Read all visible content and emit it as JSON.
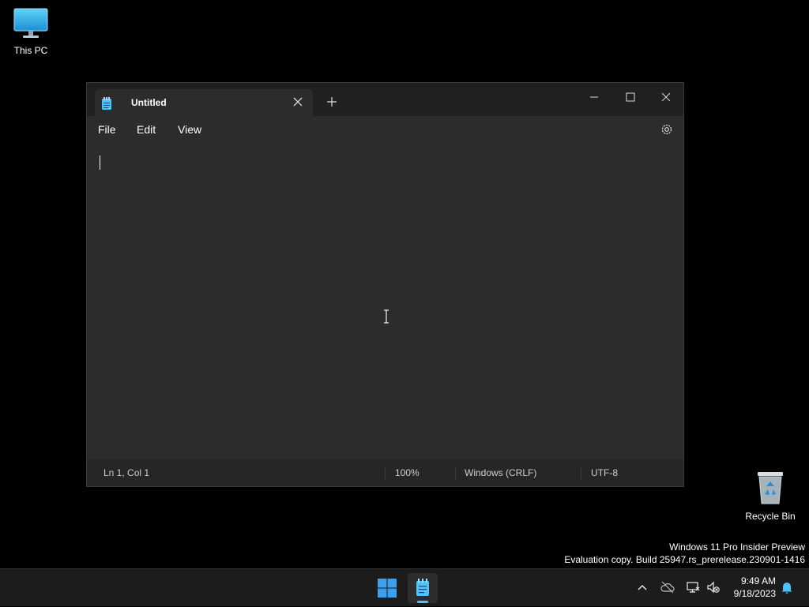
{
  "desktop": {
    "this_pc_label": "This PC",
    "recycle_bin_label": "Recycle Bin",
    "watermark_line1": "Windows 11 Pro Insider Preview",
    "watermark_line2": "Evaluation copy. Build 25947.rs_prerelease.230901-1416"
  },
  "notepad": {
    "tab_title": "Untitled",
    "menu": [
      "File",
      "Edit",
      "View"
    ],
    "content": "",
    "status": {
      "position": "Ln 1, Col 1",
      "zoom": "100%",
      "line_ending": "Windows (CRLF)",
      "encoding": "UTF-8"
    }
  },
  "taskbar": {
    "time": "9:49 AM",
    "date": "9/18/2023",
    "accent_color": "#4cc2ff"
  },
  "icons": [
    "this-pc-icon",
    "recycle-bin-icon",
    "notepad-icon",
    "close-icon",
    "plus-icon",
    "minimize-icon",
    "maximize-icon",
    "gear-icon",
    "windows-start-icon",
    "chevron-up-icon",
    "cloud-off-icon",
    "network-icon",
    "volume-muted-icon",
    "bell-icon"
  ]
}
